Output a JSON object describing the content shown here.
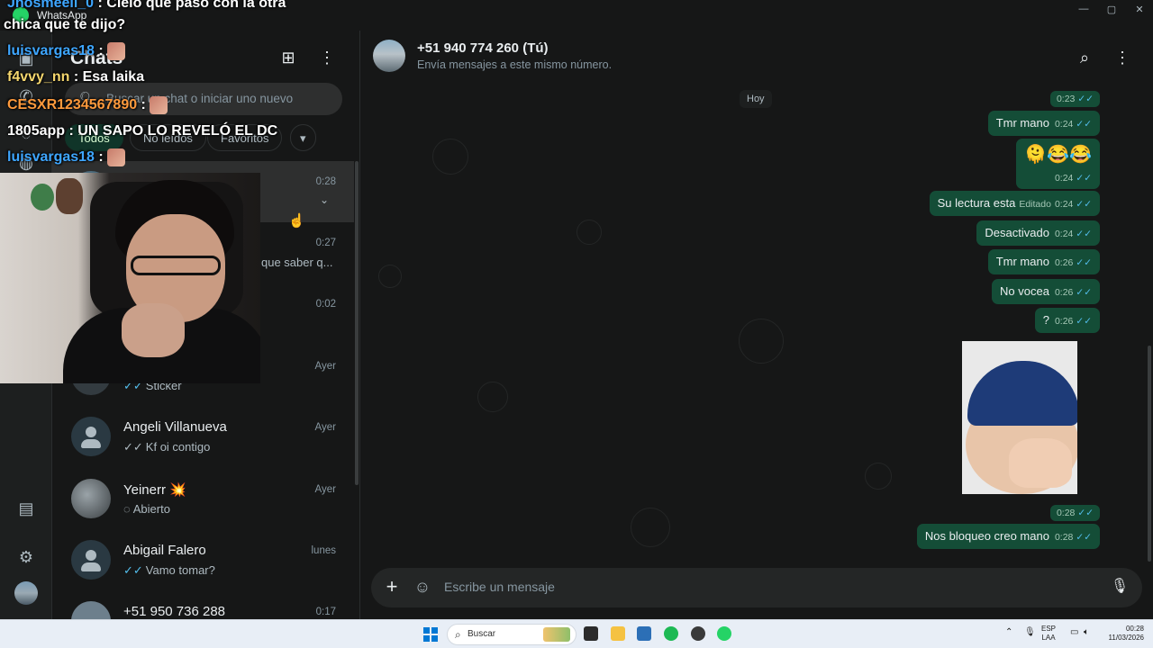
{
  "window": {
    "app_name": "WhatsApp",
    "controls": [
      "—",
      "▢",
      "✕"
    ]
  },
  "rail": {
    "icons": [
      "chat-icon",
      "calls-icon",
      "status-icon",
      "channels-icon",
      "media-icon",
      "settings-icon"
    ]
  },
  "list": {
    "title": "Chats",
    "search_placeholder": "Buscar un chat o iniciar uno nuevo",
    "filters": [
      "Todos",
      "No leídos",
      "Favoritos"
    ],
    "rows": [
      {
        "name": "",
        "time": "0:28",
        "preview": ""
      },
      {
        "name": "",
        "time": "0:27",
        "preview": "que saber q..."
      },
      {
        "name": "",
        "time": "0:02",
        "preview": ""
      },
      {
        "name": "",
        "time": "Ayer",
        "preview": "Sticker"
      },
      {
        "name": "Angeli Villanueva",
        "time": "Ayer",
        "preview": "Kf oi contigo"
      },
      {
        "name": "Yeinerr 💥",
        "time": "Ayer",
        "preview": "Abierto"
      },
      {
        "name": "Abigail Falero",
        "time": "lunes",
        "preview": "Vamo tomar?"
      },
      {
        "name": "+51 950 736 288",
        "time": "0:17",
        "preview": ""
      }
    ]
  },
  "chat": {
    "title": "+51 940 774 260 (Tú)",
    "subtitle": "Envía mensajes a este mismo número.",
    "day": "Hoy",
    "messages": [
      {
        "text": "",
        "time": "0:23"
      },
      {
        "text": "Tmr mano",
        "time": "0:24"
      },
      {
        "text": "🫠😂😂",
        "time": "0:24"
      },
      {
        "text": "Su lectura esta",
        "edited": "Editado",
        "time": "0:24"
      },
      {
        "text": "Desactivado",
        "time": "0:24"
      },
      {
        "text": "Tmr mano",
        "time": "0:26"
      },
      {
        "text": "No vocea",
        "time": "0:26"
      },
      {
        "text": "?",
        "time": "0:26"
      },
      {
        "text": "",
        "time": "0:28"
      },
      {
        "text": "Nos bloqueo creo mano",
        "time": "0:28"
      }
    ],
    "composer_placeholder": "Escribe un mensaje"
  },
  "overlay": {
    "lines": [
      {
        "user": "Jhosmeell_0",
        "text": " : Cielo que pasó con la otra"
      },
      {
        "user": "",
        "text": "chica que te dijo?"
      },
      {
        "user": "luisvargas18",
        "text": " :"
      },
      {
        "user": "f4vvy_nn",
        "text": " : Esa laika"
      },
      {
        "user": "CESXR1234567890",
        "text": " :"
      },
      {
        "user": "1805app",
        "text": " : UN SAPO LO REVELÓ EL DC"
      },
      {
        "user": "luisvargas18",
        "text": " :"
      }
    ]
  },
  "taskbar": {
    "search_label": "Buscar",
    "lang_1": "ESP",
    "lang_2": "LAA",
    "time": "00:28",
    "date": "11/03/2026"
  },
  "colors": {
    "accent": "#25d366",
    "outgoing_bubble": "#144d37",
    "read_ticks": "#53bdeb"
  }
}
